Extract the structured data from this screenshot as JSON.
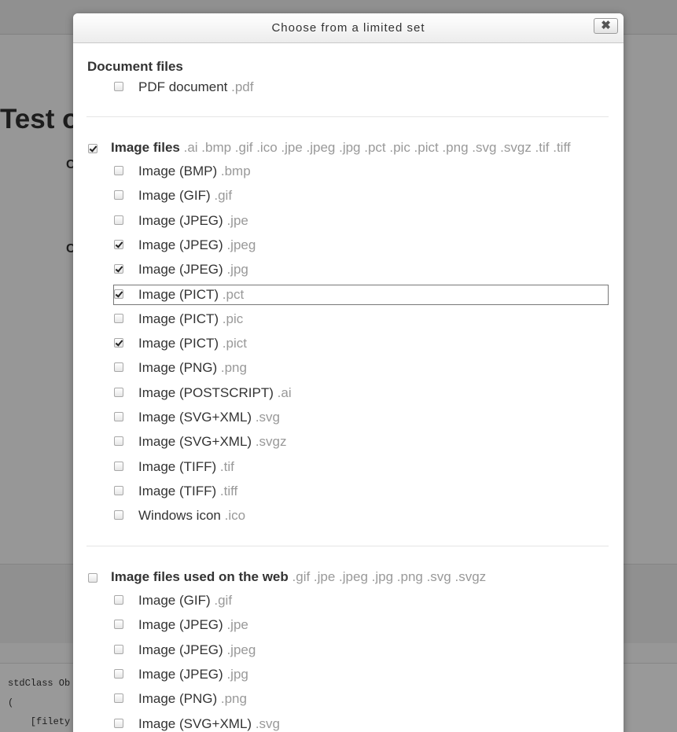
{
  "background": {
    "heading": "Test o",
    "labels": [
      "C",
      "C"
    ],
    "debug_lines": [
      "stdClass Ob",
      "(",
      "    [filety"
    ]
  },
  "dialog": {
    "title": "Choose from a limited set",
    "close_label": "✖",
    "groups": [
      {
        "heading": "Document files",
        "has_checkbox": false,
        "checked": false,
        "extensions": "",
        "items": [
          {
            "label": "PDF document",
            "ext": ".pdf",
            "checked": false
          }
        ]
      },
      {
        "heading": "Image files",
        "has_checkbox": true,
        "checked": true,
        "extensions": ".ai .bmp .gif .ico .jpe .jpeg .jpg .pct .pic .pict .png .svg .svgz .tif .tiff",
        "items": [
          {
            "label": "Image (BMP)",
            "ext": ".bmp",
            "checked": false
          },
          {
            "label": "Image (GIF)",
            "ext": ".gif",
            "checked": false
          },
          {
            "label": "Image (JPEG)",
            "ext": ".jpe",
            "checked": false
          },
          {
            "label": "Image (JPEG)",
            "ext": ".jpeg",
            "checked": true
          },
          {
            "label": "Image (JPEG)",
            "ext": ".jpg",
            "checked": true
          },
          {
            "label": "Image (PICT)",
            "ext": ".pct",
            "checked": true,
            "focused": true
          },
          {
            "label": "Image (PICT)",
            "ext": ".pic",
            "checked": false
          },
          {
            "label": "Image (PICT)",
            "ext": ".pict",
            "checked": true
          },
          {
            "label": "Image (PNG)",
            "ext": ".png",
            "checked": false
          },
          {
            "label": "Image (POSTSCRIPT)",
            "ext": ".ai",
            "checked": false
          },
          {
            "label": "Image (SVG+XML)",
            "ext": ".svg",
            "checked": false
          },
          {
            "label": "Image (SVG+XML)",
            "ext": ".svgz",
            "checked": false
          },
          {
            "label": "Image (TIFF)",
            "ext": ".tif",
            "checked": false
          },
          {
            "label": "Image (TIFF)",
            "ext": ".tiff",
            "checked": false
          },
          {
            "label": "Windows icon",
            "ext": ".ico",
            "checked": false
          }
        ]
      },
      {
        "heading": "Image files used on the web",
        "has_checkbox": true,
        "checked": false,
        "extensions": ".gif .jpe .jpeg .jpg .png .svg .svgz",
        "items": [
          {
            "label": "Image (GIF)",
            "ext": ".gif",
            "checked": false
          },
          {
            "label": "Image (JPEG)",
            "ext": ".jpe",
            "checked": false
          },
          {
            "label": "Image (JPEG)",
            "ext": ".jpeg",
            "checked": false
          },
          {
            "label": "Image (JPEG)",
            "ext": ".jpg",
            "checked": false
          },
          {
            "label": "Image (PNG)",
            "ext": ".png",
            "checked": false
          },
          {
            "label": "Image (SVG+XML)",
            "ext": ".svg",
            "checked": false
          }
        ]
      }
    ]
  }
}
